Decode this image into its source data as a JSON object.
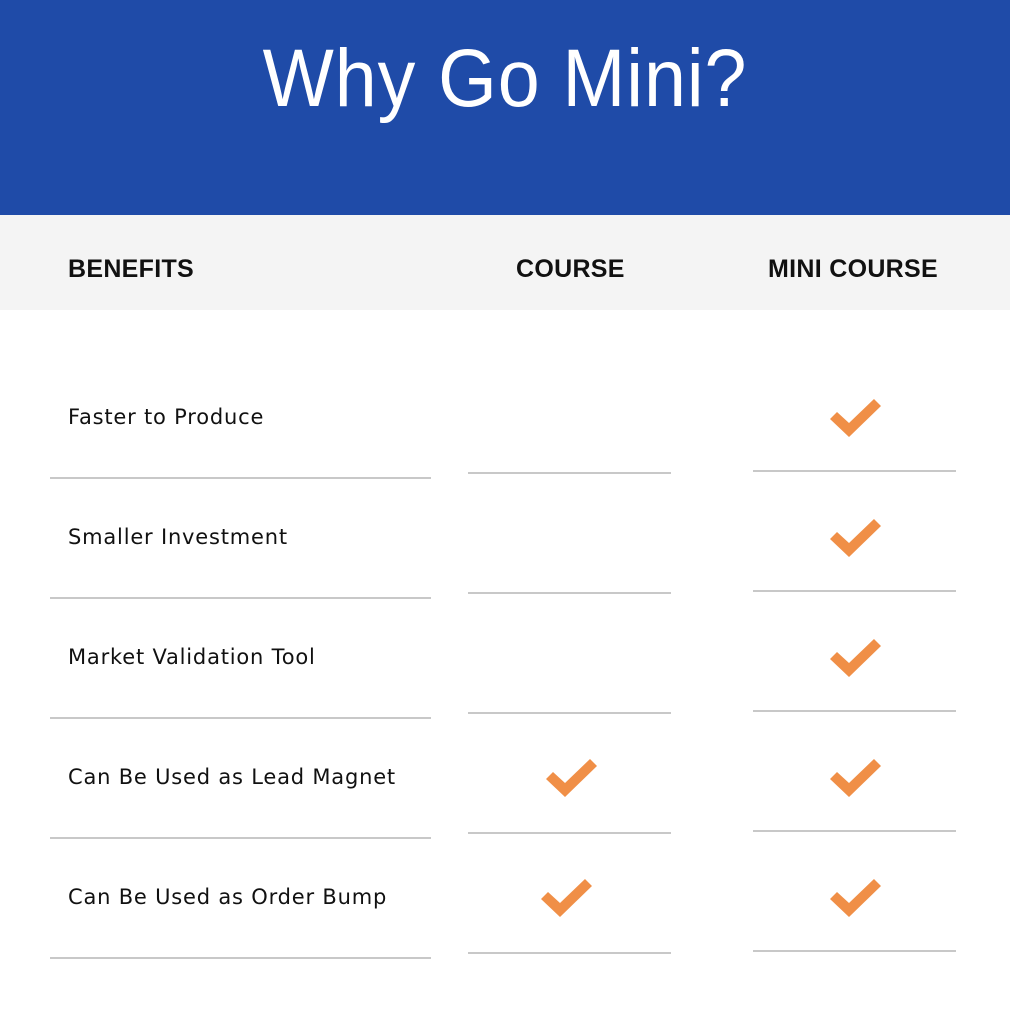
{
  "title": "Why Go Mini?",
  "colors": {
    "header_bg": "#1f4ba8",
    "band_bg": "#f4f4f4",
    "check": "#f08f47",
    "divider": "#c8c8c8"
  },
  "columns": [
    "BENEFITS",
    "COURSE",
    "MINI COURSE"
  ],
  "chart_data": {
    "type": "table",
    "title": "Why Go Mini?",
    "columns": [
      "BENEFITS",
      "COURSE",
      "MINI COURSE"
    ],
    "rows": [
      {
        "benefit": "Faster to Produce",
        "course": false,
        "mini_course": true
      },
      {
        "benefit": "Smaller Investment",
        "course": false,
        "mini_course": true
      },
      {
        "benefit": "Market Validation Tool",
        "course": false,
        "mini_course": true
      },
      {
        "benefit": "Can Be Used as Lead Magnet",
        "course": true,
        "mini_course": true
      },
      {
        "benefit": "Can Be Used as Order Bump",
        "course": true,
        "mini_course": true
      }
    ]
  },
  "icons": {
    "check": "checkmark-icon"
  }
}
